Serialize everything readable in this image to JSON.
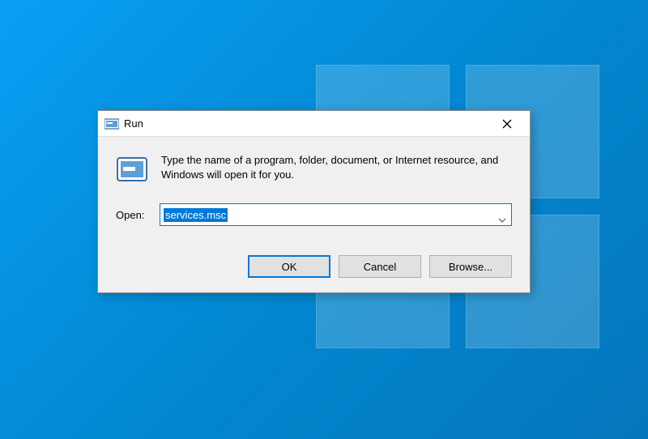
{
  "desktop": {
    "background": "windows10-blue"
  },
  "dialog": {
    "title": "Run",
    "description": "Type the name of a program, folder, document, or Internet resource, and Windows will open it for you.",
    "open_label": "Open:",
    "open_value": "services.msc",
    "buttons": {
      "ok": "OK",
      "cancel": "Cancel",
      "browse": "Browse..."
    }
  }
}
